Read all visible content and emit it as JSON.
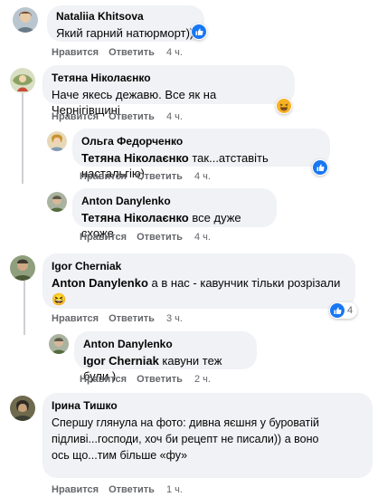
{
  "comments": [
    {
      "name": "Nataliia Khitsova",
      "mention": "",
      "text": "Який гарний натюрморт))",
      "actions": [
        "Нравится",
        "Ответить"
      ],
      "time": "4 ч.",
      "reaction": "like",
      "reaction_count": ""
    },
    {
      "name": "Тетяна Ніколаєнко",
      "mention": "",
      "text": "Наче якесь дежавю. Все як на Чернігівщині",
      "actions": [
        "Нравится",
        "Ответить"
      ],
      "time": "4 ч.",
      "reaction": "haha",
      "reaction_count": ""
    },
    {
      "name": "Ольга Федорченко",
      "mention": "Тетяна Ніколаєнко",
      "text": "так...атставіть настальгію)",
      "actions": [
        "Нравится",
        "Ответить"
      ],
      "time": "4 ч.",
      "reaction": "like",
      "reaction_count": ""
    },
    {
      "name": "Anton Danylenko",
      "mention": "Тетяна Ніколаєнко",
      "text": "все дуже схоже",
      "actions": [
        "Нравится",
        "Ответить"
      ],
      "time": "4 ч.",
      "reaction": "",
      "reaction_count": ""
    },
    {
      "name": "Igor Cherniak",
      "mention": "Anton Danylenko",
      "text": "а в нас - кавунчик тільки розрізали",
      "emoji": "😆",
      "actions": [
        "Нравится",
        "Ответить"
      ],
      "time": "3 ч.",
      "reaction": "like",
      "reaction_count": "4"
    },
    {
      "name": "Anton Danylenko",
      "mention": "Igor Cherniak",
      "text": "кавуни теж були )",
      "actions": [
        "Нравится",
        "Ответить"
      ],
      "time": "2 ч.",
      "reaction": "",
      "reaction_count": ""
    },
    {
      "name": "Ірина Тишко",
      "mention": "",
      "text_lines": [
        "Спершу глянула на фото: дивна яєшня у буроватій",
        "підливі...господи, хоч би рецепт не писали)) а воно",
        "ось що...тим більше «фу»"
      ],
      "actions": [
        "Нравится",
        "Ответить"
      ],
      "time": "1 ч.",
      "reaction": "",
      "reaction_count": ""
    }
  ],
  "colors": {
    "bubble": "#f0f2f5",
    "meta": "#65676b",
    "like": "#1877f2",
    "haha": "#f7b125"
  },
  "icons": [
    "avatar",
    "like-reaction-icon",
    "haha-reaction-icon"
  ]
}
